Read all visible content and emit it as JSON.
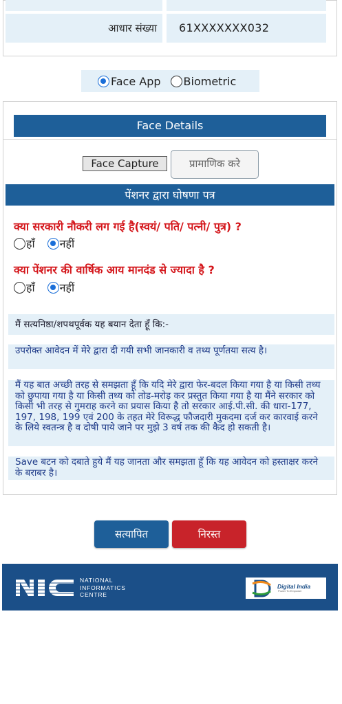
{
  "aadhaar": {
    "label": "आधार संख्या",
    "value": "61XXXXXXX032"
  },
  "auth_mode": {
    "options": [
      {
        "label": "Face App",
        "checked": true
      },
      {
        "label": "Biometric",
        "checked": false
      }
    ]
  },
  "face_details": {
    "header": "Face Details",
    "capture_button": "Face Capture",
    "authenticate_button": "प्रामाणिक करे"
  },
  "declaration": {
    "header": "पेंशनर द्वारा घोषणा पत्र",
    "q1": {
      "text": "क्या सरकारी नौकरी लग गई है(स्वयं/ पति/ पत्नी/ पुत्र) ?",
      "yes": "हाँ",
      "no": "नहीं",
      "selected": "no"
    },
    "q2": {
      "text": "क्या पेंशनर की वार्षिक आय मानदंड से ज्यादा है ?",
      "yes": "हाँ",
      "no": "नहीं",
      "selected": "no"
    },
    "statement_intro": "मैं सत्यनिष्ठा/शपथपूर्वक यह बयान देता हूँ कि:-",
    "statement_1": "उपरोक्त आवेदन में मेरे द्वारा दी गयी सभी जानकारी व तथ्य पूर्णतया सत्य है।",
    "statement_2": "मैं यह बात अच्छी तरह से समझता हूँ कि यदि मेरे द्वारा फेर-बदल किया गया है या किसी तथ्य को छुपाया गया है या किसी तथ्य को तोड-मरोड़ कर प्रस्तुत किया गया है या मैंने सरकार को किसी भी तरह से गुमराह करने का प्रयास किया है तो सरकार आई.पी.सी. की धारा-177, 197, 198, 199 एवं 200 के तहत मेरे विरूद्ध फौजदारी मुकदमा दर्ज कर कारवाई करने के लिये स्वतन्त्र है व दोषी पाये जाने पर मुझे 3 वर्ष तक की कैद हो सकती है।",
    "statement_3": "Save बटन को दबाते हुये मैं यह जानता और समझता हूँ कि यह आवेदन को हस्ताक्षर करने के बराबर है।"
  },
  "actions": {
    "verify": "सत्यापित",
    "cancel": "निरस्त"
  },
  "footer": {
    "nic_line1": "NATIONAL",
    "nic_line2": "INFORMATICS",
    "nic_line3": "CENTRE",
    "digital_india": "Digital India",
    "digital_india_tagline": "Power To Empower"
  },
  "colors": {
    "primary_blue": "#1e5f99",
    "danger_red": "#c8232a",
    "question_red": "#d4161b",
    "panel_bg": "#e4f0f8"
  }
}
